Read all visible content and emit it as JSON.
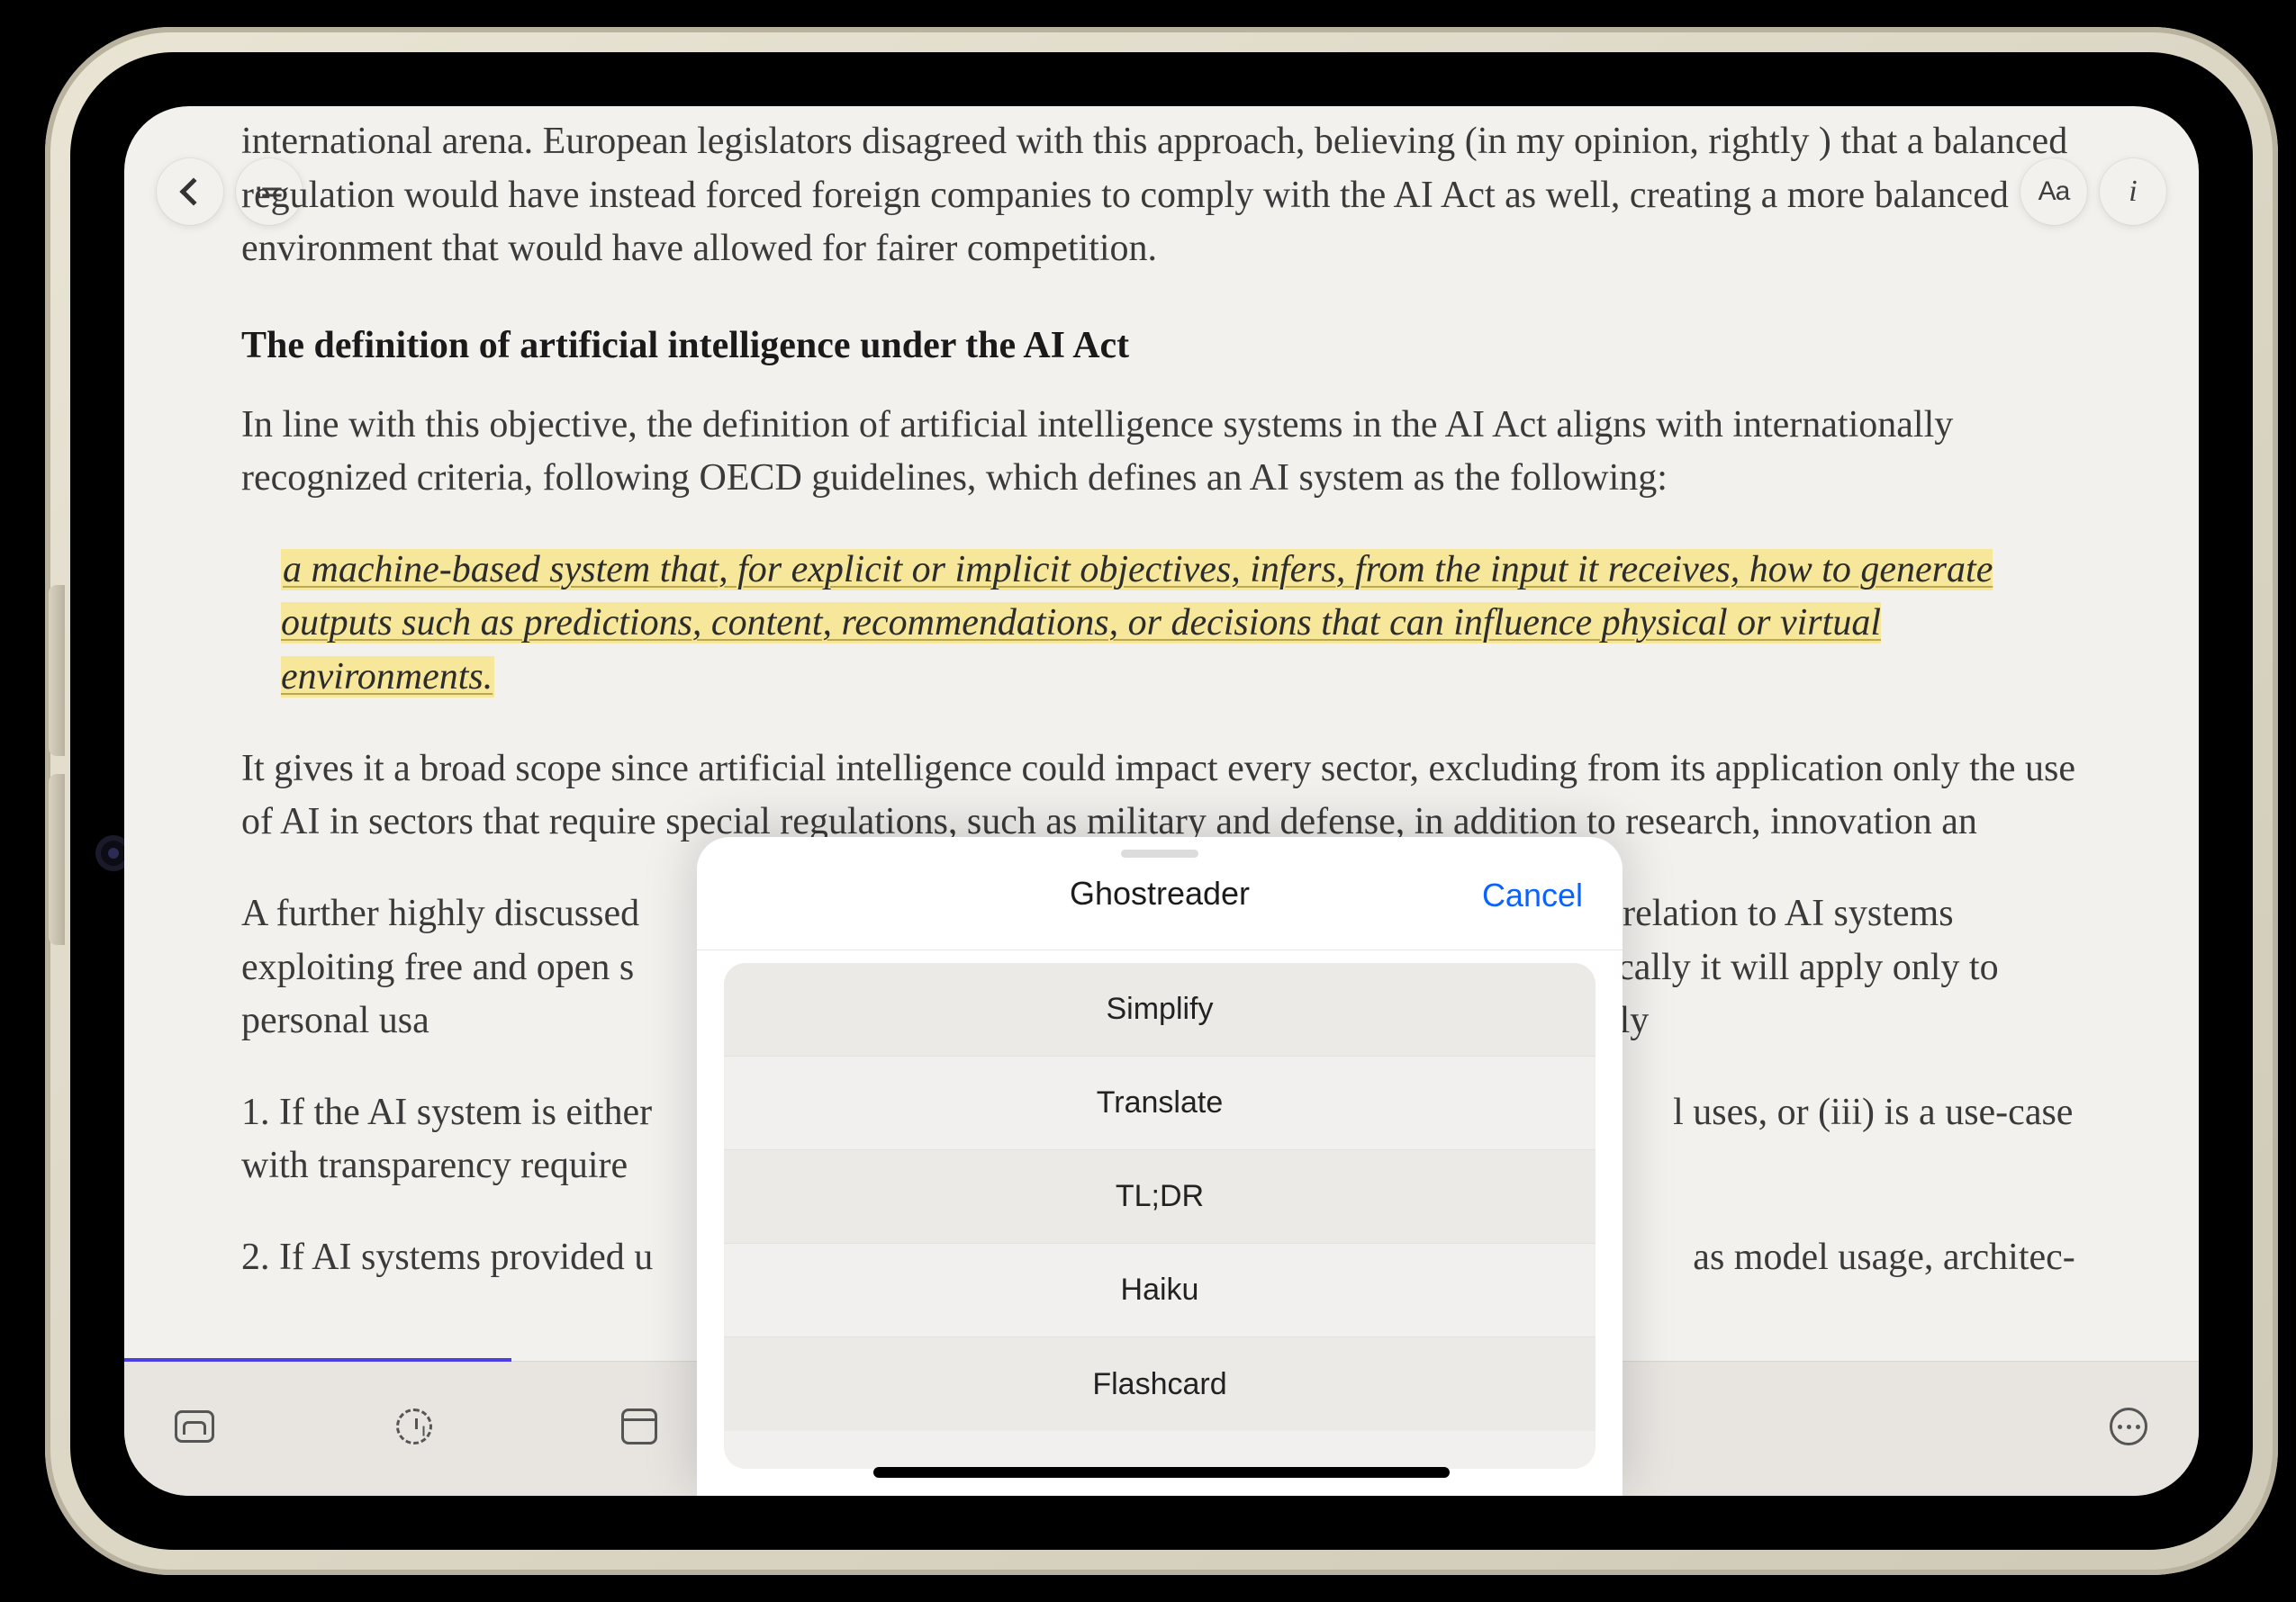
{
  "toolbar": {
    "back": "Back",
    "toc": "Table of contents",
    "appearance": "Aa",
    "info": "i"
  },
  "article": {
    "para_intro": "international arena. European legislators disagreed with this approach, believing (in my opinion, rightly ) that a balanced regulation would have instead forced foreign companies to comply with the AI Act as well, creating a more balanced environment that would have allowed for fairer competition.",
    "heading": "The definition of artificial intelligence under the AI Act",
    "para_def": "In line with this objective, the definition of artificial intelligence systems in the AI Act aligns with interna­tionally recognized criteria, following OECD guidelines, which defines an AI system as the following:",
    "quote": "a machine-based system that, for explicit or implicit objectives, infers, from the input it receives, how to gener­ate outputs such as predictions, content, recommendations, or decisions that can influence physical or virtual environments.",
    "para_scope": "It gives it a broad scope since artificial intelligence could impact every sector, excluding from its applica­tion only the use of AI in sectors that require special regulations, such as military and defense, in addition to research, innovation an",
    "para_oss_a": "A further highly discussed",
    "para_oss_b": "relation to AI systems exploiting free and open s",
    "para_oss_c": "rrow that basically it will apply only to personal usa",
    "para_oss_d": "not apply",
    "li1_a": "1. If the AI system is either",
    "li1_b": "l uses, or (iii) is a use-case with transparency require",
    "li2_a": "2. If AI systems provided u",
    "li2_b": "as model usage, architec-"
  },
  "sheet": {
    "title": "Ghostreader",
    "cancel": "Cancel",
    "items": [
      "Simplify",
      "Translate",
      "TL;DR",
      "Haiku",
      "Flashcard"
    ]
  },
  "bottombar": {
    "inbox": "Inbox",
    "later": "Later",
    "archive": "Archive",
    "more": "More"
  }
}
